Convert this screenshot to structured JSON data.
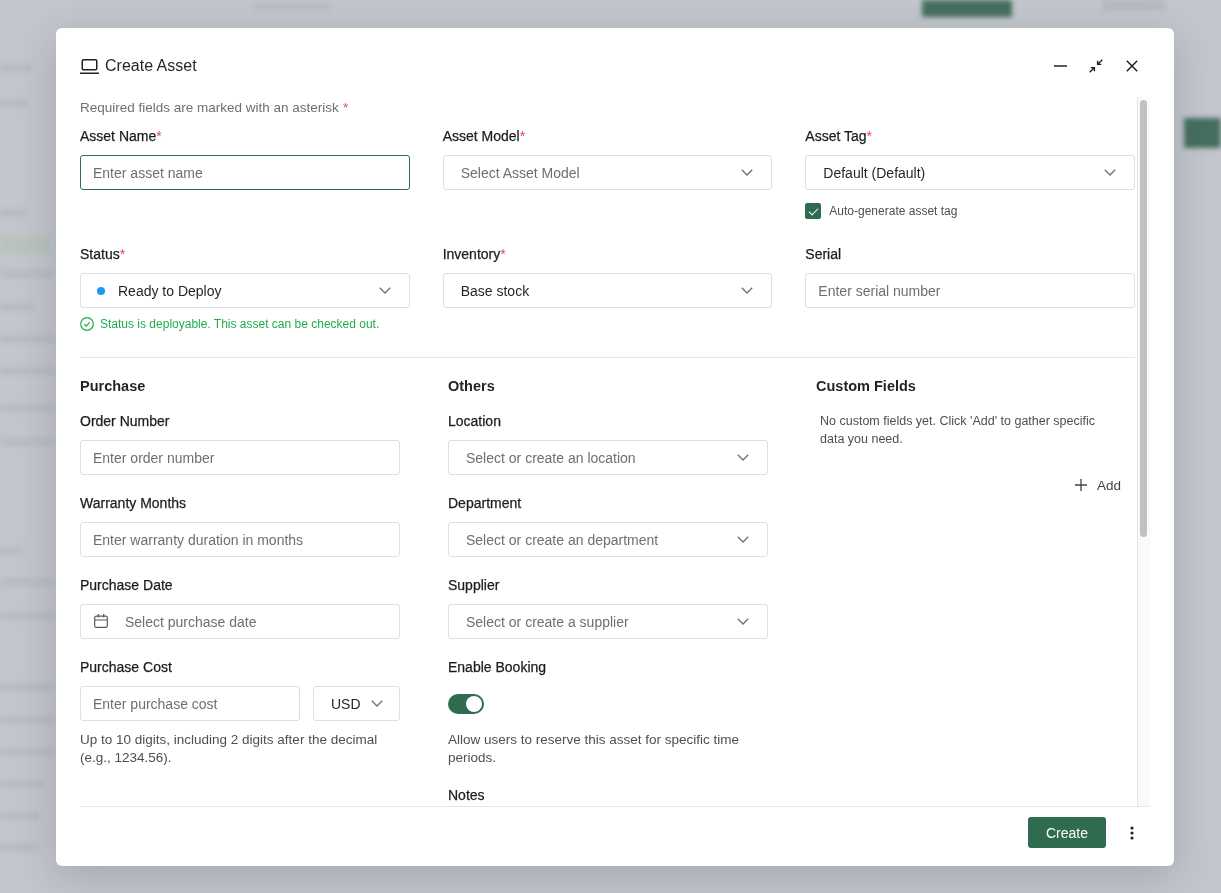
{
  "dialog": {
    "title": "Create Asset",
    "controls": [
      {
        "kind": "minimize"
      },
      {
        "kind": "collapse"
      },
      {
        "kind": "close"
      }
    ]
  },
  "required_note": {
    "text": "Required fields are marked with an asterisk",
    "mark": "*"
  },
  "main_fields": [
    {
      "kind": "text",
      "label": "Asset Name",
      "required_mark": "*",
      "placeholder": "Enter asset name",
      "focused": true
    },
    {
      "kind": "select",
      "label": "Asset Model",
      "required_mark": "*",
      "placeholder": "Select Asset Model"
    },
    {
      "kind": "select",
      "label": "Asset Tag",
      "required_mark": "*",
      "value": "Default (Default)",
      "checkbox": {
        "label": "Auto-generate asset tag",
        "checked": true
      }
    },
    {
      "kind": "status",
      "label": "Status",
      "required_mark": "*",
      "value": "Ready to Deploy",
      "color": "#1a9cf0",
      "hint": "Status is deployable. This asset can be checked out."
    },
    {
      "kind": "select",
      "label": "Inventory",
      "required_mark": "*",
      "value": "Base stock"
    },
    {
      "kind": "text",
      "label": "Serial",
      "placeholder": "Enter serial number",
      "focused": false
    }
  ],
  "sections": [
    {
      "kind": "fields",
      "title": "Purchase",
      "fields": [
        {
          "kind": "text",
          "label": "Order Number",
          "placeholder": "Enter order number",
          "focused": false
        },
        {
          "kind": "text",
          "label": "Warranty Months",
          "placeholder": "Enter warranty duration in months",
          "focused": false
        },
        {
          "kind": "date",
          "label": "Purchase Date",
          "placeholder": "Select purchase date",
          "focused": false
        },
        {
          "kind": "money",
          "label": "Purchase Cost",
          "placeholder": "Enter purchase cost",
          "focused": false,
          "currency": "USD",
          "help": "Up to 10 digits, including 2 digits after the decimal (e.g., 1234.56)."
        }
      ]
    },
    {
      "kind": "fields",
      "title": "Others",
      "fields": [
        {
          "kind": "select",
          "label": "Location",
          "placeholder": "Select or create an location"
        },
        {
          "kind": "select",
          "label": "Department",
          "placeholder": "Select or create an department"
        },
        {
          "kind": "select",
          "label": "Supplier",
          "placeholder": "Select or create a supplier"
        },
        {
          "kind": "toggle",
          "label": "Enable Booking",
          "on": true,
          "help": "Allow users to reserve this asset for specific time periods."
        },
        {
          "kind": "label",
          "label": "Notes"
        }
      ]
    },
    {
      "kind": "custom",
      "title": "Custom Fields",
      "empty_text": "No custom fields yet. Click 'Add' to gather specific data you need.",
      "add_button": "Add"
    }
  ],
  "footer": {
    "buttons": [
      {
        "kind": "primary",
        "label": "Create"
      },
      {
        "kind": "more"
      }
    ]
  }
}
